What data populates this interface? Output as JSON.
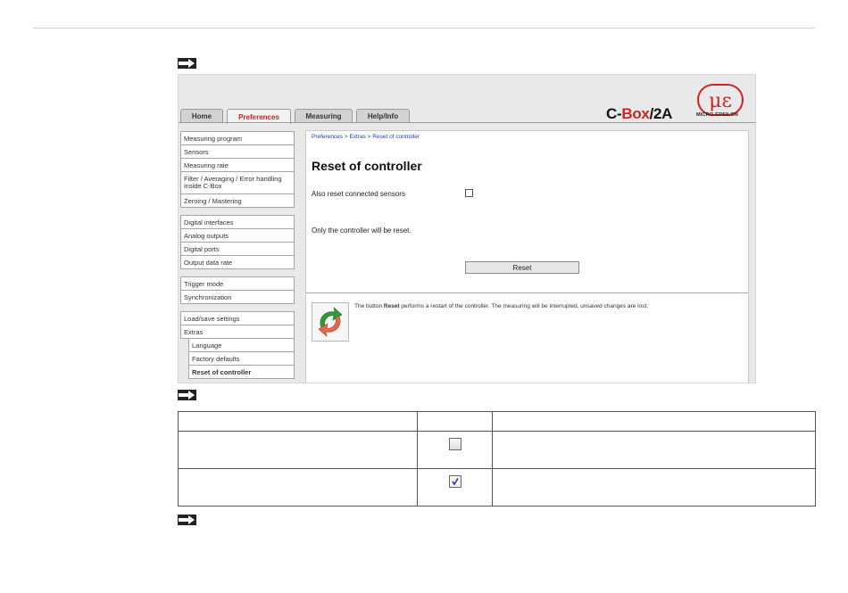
{
  "tabs": [
    {
      "label": "Home"
    },
    {
      "label": "Preferences",
      "active": true
    },
    {
      "label": "Measuring"
    },
    {
      "label": "Help/Info"
    }
  ],
  "brand": {
    "c": "C-",
    "box": "Box",
    "model": "/2A",
    "logo_text": "MICRO-EPSILON"
  },
  "menu": {
    "group1": [
      "Measuring program",
      "Sensors",
      "Measuring rate",
      "Filter / Averaging / Error handling inside C-Box",
      "Zeroing / Mastering"
    ],
    "group2": [
      "Digital interfaces",
      "Analog outputs",
      "Digital ports",
      "Output data rate"
    ],
    "group3": [
      "Trigger mode",
      "Synchronization"
    ],
    "group4": [
      "Load/save settings",
      "Extras"
    ],
    "sub": [
      "Language",
      "Factory defaults",
      "Reset of controller"
    ]
  },
  "content": {
    "breadcrumb": "Preferences > Extras > Reset of controller",
    "title": "Reset of controller",
    "checkbox_label": "Also reset connected sensors",
    "note": "Only the controller will be reset.",
    "button": "Reset",
    "info_pre": "The button ",
    "info_bold": "Reset",
    "info_post": " performs a restart of the controller. The measuring will be interrupted, unsaved changes are lost."
  },
  "table": {
    "rows": [
      {
        "checked": false
      },
      {
        "checked": true
      }
    ]
  },
  "colors": {
    "accent_red": "#d2221f",
    "link_blue": "#1d3ea8",
    "icon_green": "#2e9a3a"
  }
}
